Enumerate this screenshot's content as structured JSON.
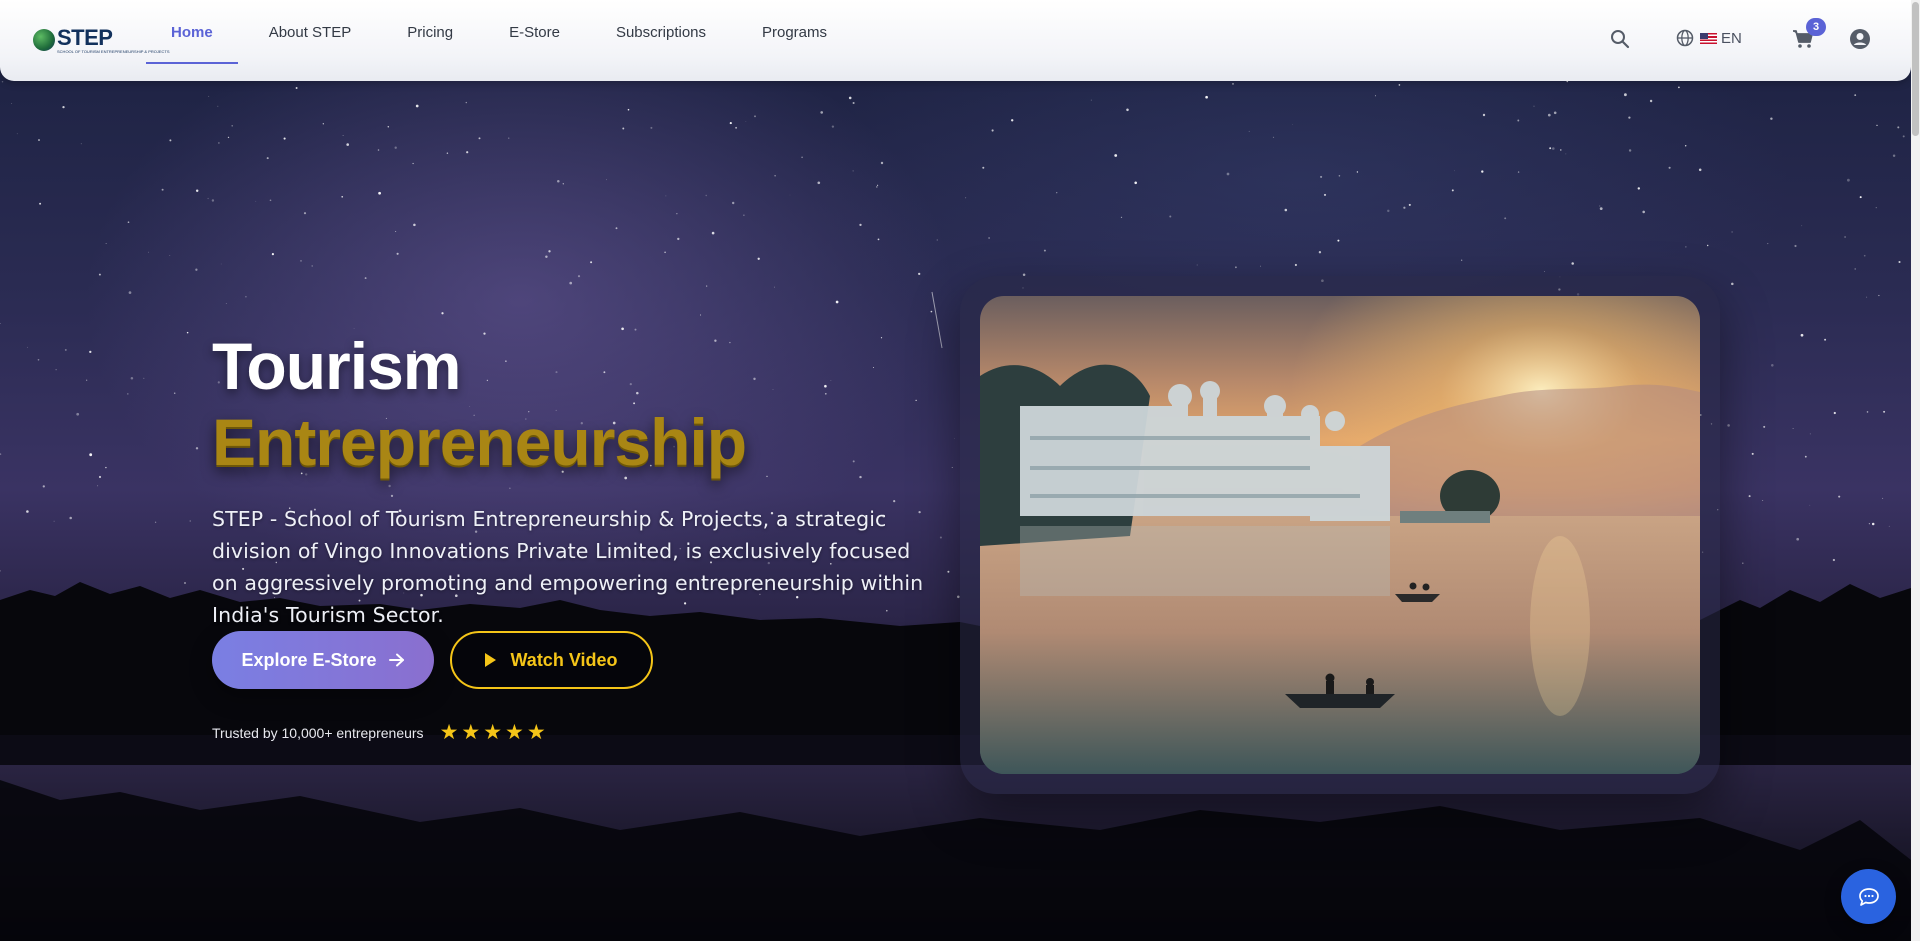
{
  "brand": {
    "logo_text": "STEP",
    "logo_tagline": "SCHOOL OF TOURISM ENTREPRENEURSHIP & PROJECTS"
  },
  "nav": {
    "items": [
      {
        "label": "Home",
        "active": true
      },
      {
        "label": "About STEP",
        "active": false
      },
      {
        "label": "Pricing",
        "active": false
      },
      {
        "label": "E-Store",
        "active": false
      },
      {
        "label": "Subscriptions",
        "active": false
      },
      {
        "label": "Programs",
        "active": false
      }
    ],
    "language_label": "EN",
    "cart_count": "3",
    "icons": [
      "search-icon",
      "globe-icon",
      "us-flag-icon",
      "cart-icon",
      "account-icon"
    ]
  },
  "hero": {
    "title_line1": "Tourism",
    "title_line2": "Entrepreneurship",
    "description": "STEP - School of Tourism Entrepreneurship & Projects, a strategic division of Vingo Innovations Private Limited, is exclusively focused on aggressively promoting and empowering entrepreneurship within India's Tourism Sector.",
    "primary_button": "Explore E-Store",
    "secondary_button": "Watch Video",
    "trust_text": "Trusted by 10,000+ entrepreneurs",
    "rating_stars": 5
  },
  "colors": {
    "accent": "#5b63d6",
    "gold": "#f5c518",
    "chat": "#2a63e0"
  },
  "widgets": {
    "chat_icon": "chat-bubble-icon"
  }
}
